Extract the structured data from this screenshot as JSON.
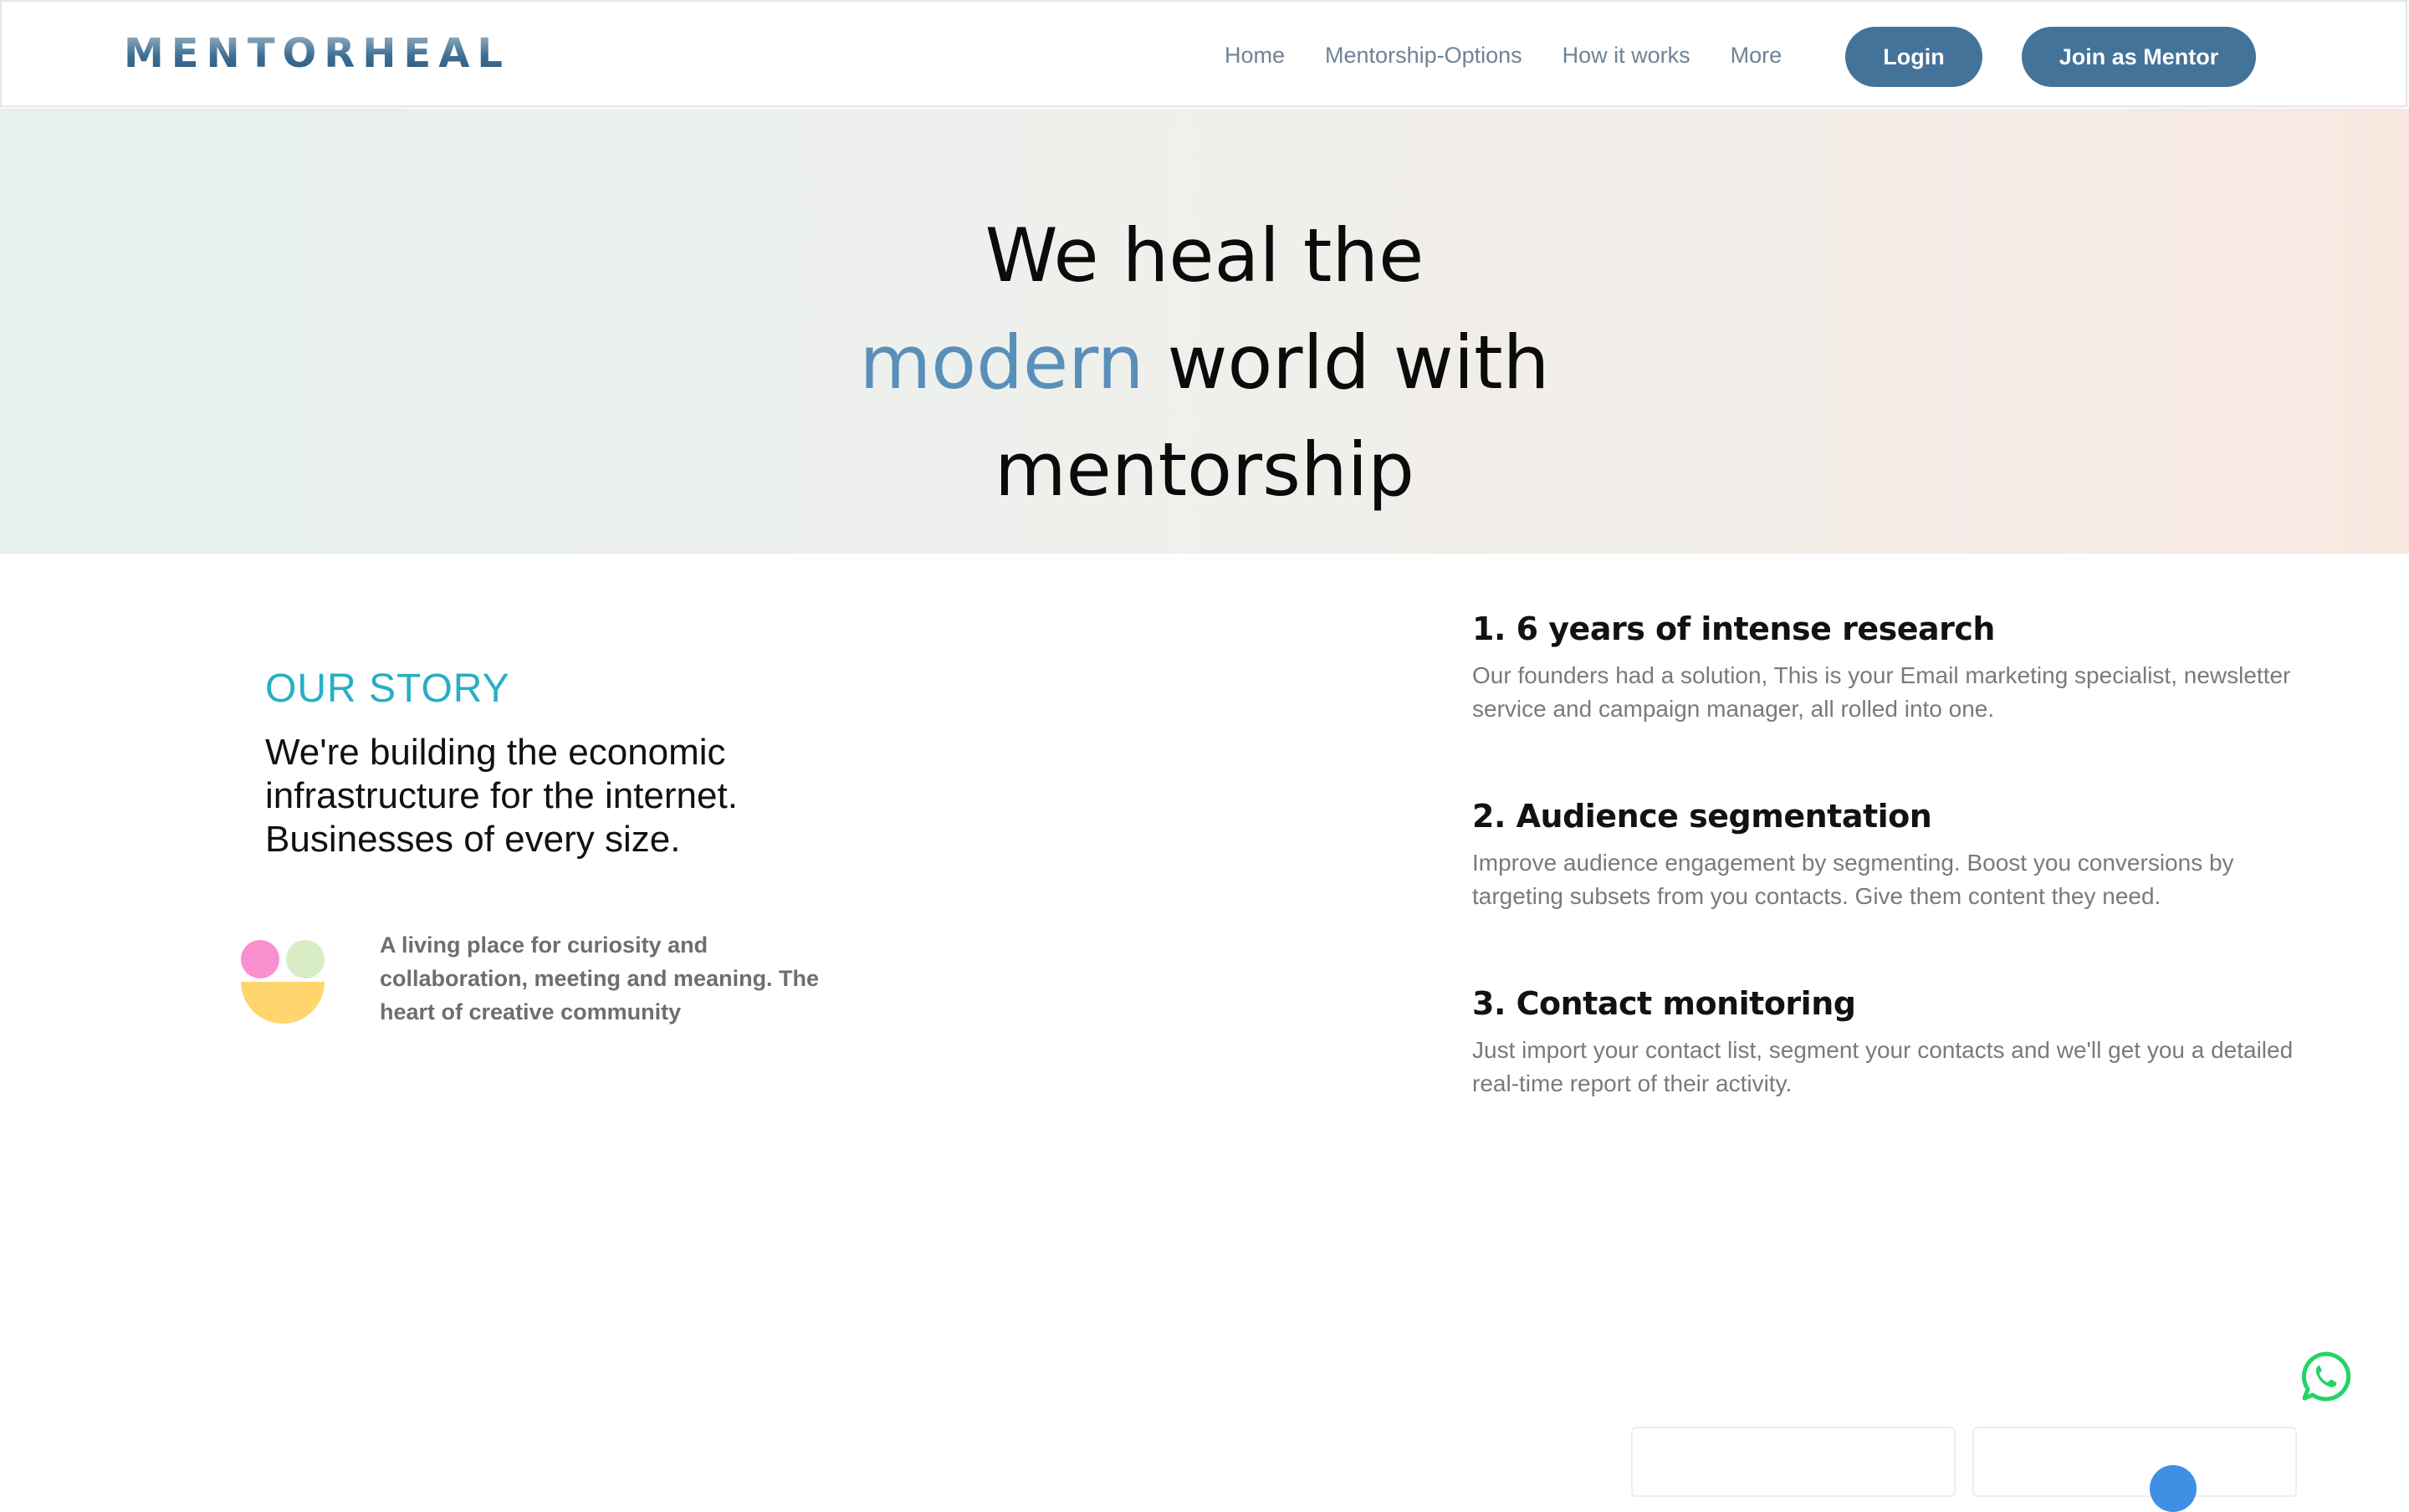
{
  "brand": {
    "logo_text": "MENTORHEAL",
    "color": "#44739a"
  },
  "nav": {
    "links": [
      "Home",
      "Mentorship-Options",
      "How it works",
      "More"
    ],
    "login_label": "Login",
    "join_label": "Join as Mentor"
  },
  "hero": {
    "line1": "We heal the",
    "line2_accent": "modern",
    "line2_rest": " world with",
    "line3": "mentorship",
    "accent_color": "#5a8fba"
  },
  "story": {
    "label": "OUR STORY",
    "heading": "We're building the economic infrastructure for the internet. Businesses of every size.",
    "description": "A living place for curiosity and collaboration, meeting and meaning. The heart of creative community"
  },
  "features": [
    {
      "title": "1. 6 years of intense research",
      "description": "Our founders had a solution, This is your Email marketing specialist, newsletter service and campaign manager, all rolled into one."
    },
    {
      "title": "2. Audience segmentation",
      "description": "Improve audience engagement by segmenting. Boost you conversions by targeting subsets from you contacts. Give them content they need."
    },
    {
      "title": "3. Contact monitoring",
      "description": "Just import your contact list, segment your contacts and we'll get you a detailed real-time report of their activity."
    }
  ],
  "icons": {
    "whatsapp": "whatsapp-icon",
    "whatsapp_color": "#25d366"
  }
}
